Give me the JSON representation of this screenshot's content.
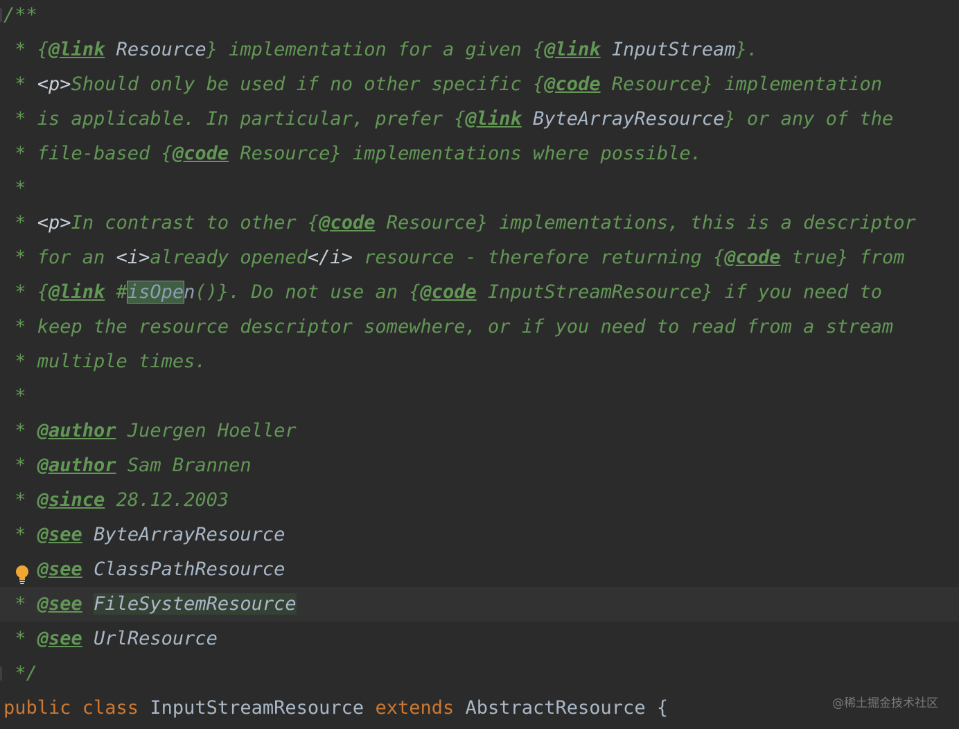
{
  "editor": {
    "lines": [
      {
        "segments": [
          {
            "t": "/**",
            "k": "c"
          }
        ]
      },
      {
        "segments": [
          {
            "t": " * ",
            "k": "c"
          },
          {
            "t": "{",
            "k": "c"
          },
          {
            "t": "@link",
            "k": "tag"
          },
          {
            "t": " ",
            "k": "c"
          },
          {
            "t": "Resource",
            "k": "ref light"
          },
          {
            "t": "} implementation for a given {",
            "k": "c"
          },
          {
            "t": "@link",
            "k": "tag"
          },
          {
            "t": " ",
            "k": "c"
          },
          {
            "t": "InputStream",
            "k": "ref light"
          },
          {
            "t": "}.",
            "k": "c"
          }
        ]
      },
      {
        "segments": [
          {
            "t": " * ",
            "k": "c"
          },
          {
            "t": "<p>",
            "k": "html"
          },
          {
            "t": "Should only be used if no other specific {",
            "k": "c"
          },
          {
            "t": "@code",
            "k": "tag"
          },
          {
            "t": " Resource} implementation",
            "k": "c"
          }
        ]
      },
      {
        "segments": [
          {
            "t": " * is applicable. In particular, prefer {",
            "k": "c"
          },
          {
            "t": "@link",
            "k": "tag"
          },
          {
            "t": " ",
            "k": "c"
          },
          {
            "t": "ByteArrayResource",
            "k": "ref light"
          },
          {
            "t": "} or any of the",
            "k": "c"
          }
        ]
      },
      {
        "segments": [
          {
            "t": " * file-based {",
            "k": "c"
          },
          {
            "t": "@code",
            "k": "tag"
          },
          {
            "t": " Resource} implementations where possible.",
            "k": "c"
          }
        ]
      },
      {
        "segments": [
          {
            "t": " *",
            "k": "c"
          }
        ]
      },
      {
        "segments": [
          {
            "t": " * ",
            "k": "c"
          },
          {
            "t": "<p>",
            "k": "html"
          },
          {
            "t": "In contrast to other {",
            "k": "c"
          },
          {
            "t": "@code",
            "k": "tag"
          },
          {
            "t": " Resource} implementations, this is a descriptor",
            "k": "c"
          }
        ]
      },
      {
        "segments": [
          {
            "t": " * for an ",
            "k": "c"
          },
          {
            "t": "<i>",
            "k": "html"
          },
          {
            "t": "already opened",
            "k": "c"
          },
          {
            "t": "</i>",
            "k": "html"
          },
          {
            "t": " resource - therefore returning {",
            "k": "c"
          },
          {
            "t": "@code",
            "k": "tag"
          },
          {
            "t": " true} from",
            "k": "c"
          }
        ]
      },
      {
        "segments": [
          {
            "t": " * {",
            "k": "c"
          },
          {
            "t": "@link",
            "k": "tag"
          },
          {
            "t": " #",
            "k": "c"
          },
          {
            "t": "isOpe",
            "k": "ref boxed"
          },
          {
            "t": "n",
            "k": "ref"
          },
          {
            "t": "()}. Do not use an {",
            "k": "c"
          },
          {
            "t": "@code",
            "k": "tag"
          },
          {
            "t": " InputStreamResource} if you need to",
            "k": "c"
          }
        ]
      },
      {
        "segments": [
          {
            "t": " * keep the resource descriptor somewhere, or if you need to read from a stream",
            "k": "c"
          }
        ]
      },
      {
        "segments": [
          {
            "t": " * multiple times.",
            "k": "c"
          }
        ]
      },
      {
        "segments": [
          {
            "t": " *",
            "k": "c"
          }
        ]
      },
      {
        "segments": [
          {
            "t": " * ",
            "k": "c"
          },
          {
            "t": "@author",
            "k": "tag"
          },
          {
            "t": " Juergen Hoeller",
            "k": "c"
          }
        ]
      },
      {
        "segments": [
          {
            "t": " * ",
            "k": "c"
          },
          {
            "t": "@author",
            "k": "tag"
          },
          {
            "t": " Sam Brannen",
            "k": "c"
          }
        ]
      },
      {
        "segments": [
          {
            "t": " * ",
            "k": "c"
          },
          {
            "t": "@since",
            "k": "tag"
          },
          {
            "t": " 28.12.2003",
            "k": "c"
          }
        ]
      },
      {
        "segments": [
          {
            "t": " * ",
            "k": "c"
          },
          {
            "t": "@see",
            "k": "tag"
          },
          {
            "t": " ",
            "k": "c"
          },
          {
            "t": "ByteArrayResource",
            "k": "ref light"
          }
        ]
      },
      {
        "segments": [
          {
            "t": "   ",
            "k": "c"
          },
          {
            "t": "@see",
            "k": "tag"
          },
          {
            "t": " ",
            "k": "c"
          },
          {
            "t": "ClassPathResource",
            "k": "ref light"
          }
        ]
      },
      {
        "segments": [
          {
            "t": " * ",
            "k": "c"
          },
          {
            "t": "@see",
            "k": "tag"
          },
          {
            "t": " ",
            "k": "c"
          },
          {
            "t": "FileSystemResource",
            "k": "ref light hl"
          }
        ],
        "current": true
      },
      {
        "segments": [
          {
            "t": " * ",
            "k": "c"
          },
          {
            "t": "@see",
            "k": "tag"
          },
          {
            "t": " ",
            "k": "c"
          },
          {
            "t": "UrlResource",
            "k": "ref light"
          }
        ]
      },
      {
        "segments": [
          {
            "t": " */",
            "k": "c"
          }
        ]
      },
      {
        "segments": [
          {
            "t": "public class ",
            "k": "kw"
          },
          {
            "t": "InputStreamResource ",
            "k": "plain"
          },
          {
            "t": "extends ",
            "k": "kw"
          },
          {
            "t": "AbstractResource {",
            "k": "plain"
          }
        ]
      }
    ]
  },
  "icons": {
    "intention": "lightbulb-icon"
  },
  "watermark": "@稀土掘金技术社区"
}
